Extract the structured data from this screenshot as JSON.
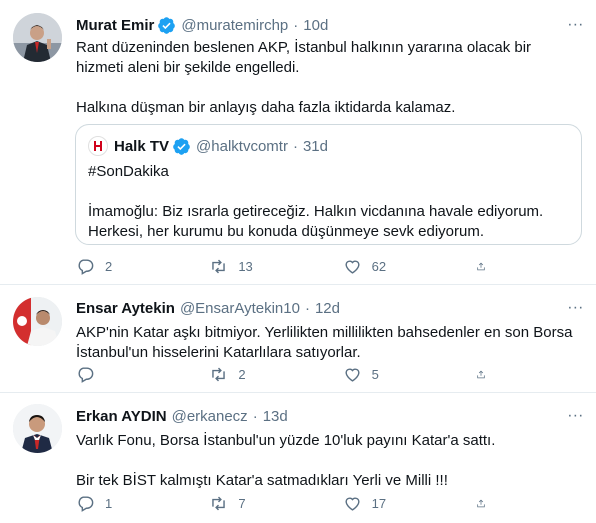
{
  "tweets": [
    {
      "name": "Murat Emir",
      "verified": true,
      "handle": "@muratemirchp",
      "time": "10d",
      "body": [
        "Rant düzeninden beslenen AKP, İstanbul halkının yararına olacak bir hizmeti aleni bir şekilde engelledi.",
        "",
        "Halkına düşman bir anlayış daha fazla iktidarda kalamaz."
      ],
      "quote": {
        "name": "Halk TV",
        "verified": true,
        "handle": "@halktvcomtr",
        "time": "31d",
        "body": [
          "#SonDakika",
          "",
          "İmamoğlu: Biz ısrarla getireceğiz. Halkın vicdanına havale ediyorum.",
          "Herkesi, her kurumu bu konuda düşünmeye sevk ediyorum."
        ]
      },
      "replies": "2",
      "retweets": "13",
      "likes": "62"
    },
    {
      "name": "Ensar Aytekin",
      "verified": false,
      "handle": "@EnsarAytekin10",
      "time": "12d",
      "body": [
        "AKP'nin Katar aşkı bitmiyor.  Yerlilikten millilikten bahsedenler en son Borsa İstanbul'un hisselerini Katarlılara satıyorlar."
      ],
      "replies": "",
      "retweets": "2",
      "likes": "5"
    },
    {
      "name": "Erkan AYDIN",
      "verified": false,
      "handle": "@erkanecz",
      "time": "13d",
      "body": [
        "Varlık Fonu, Borsa İstanbul'un yüzde 10'luk payını Katar'a sattı.",
        "",
        "Bir tek BİST kalmıştı Katar'a satmadıkları Yerli ve Milli !!!"
      ],
      "replies": "1",
      "retweets": "7",
      "likes": "17"
    }
  ],
  "ui": {
    "separator": "·",
    "more": "∙∙∙"
  },
  "icons": {
    "reply": "reply-icon",
    "retweet": "retweet-icon",
    "like": "heart-icon",
    "share": "share-icon",
    "verified": "verified-badge-icon",
    "more": "more-icon"
  },
  "colors": {
    "text": "#0f1419",
    "muted": "#5b7083",
    "verified": "#1da1f2",
    "border": "#e6ecf0"
  }
}
